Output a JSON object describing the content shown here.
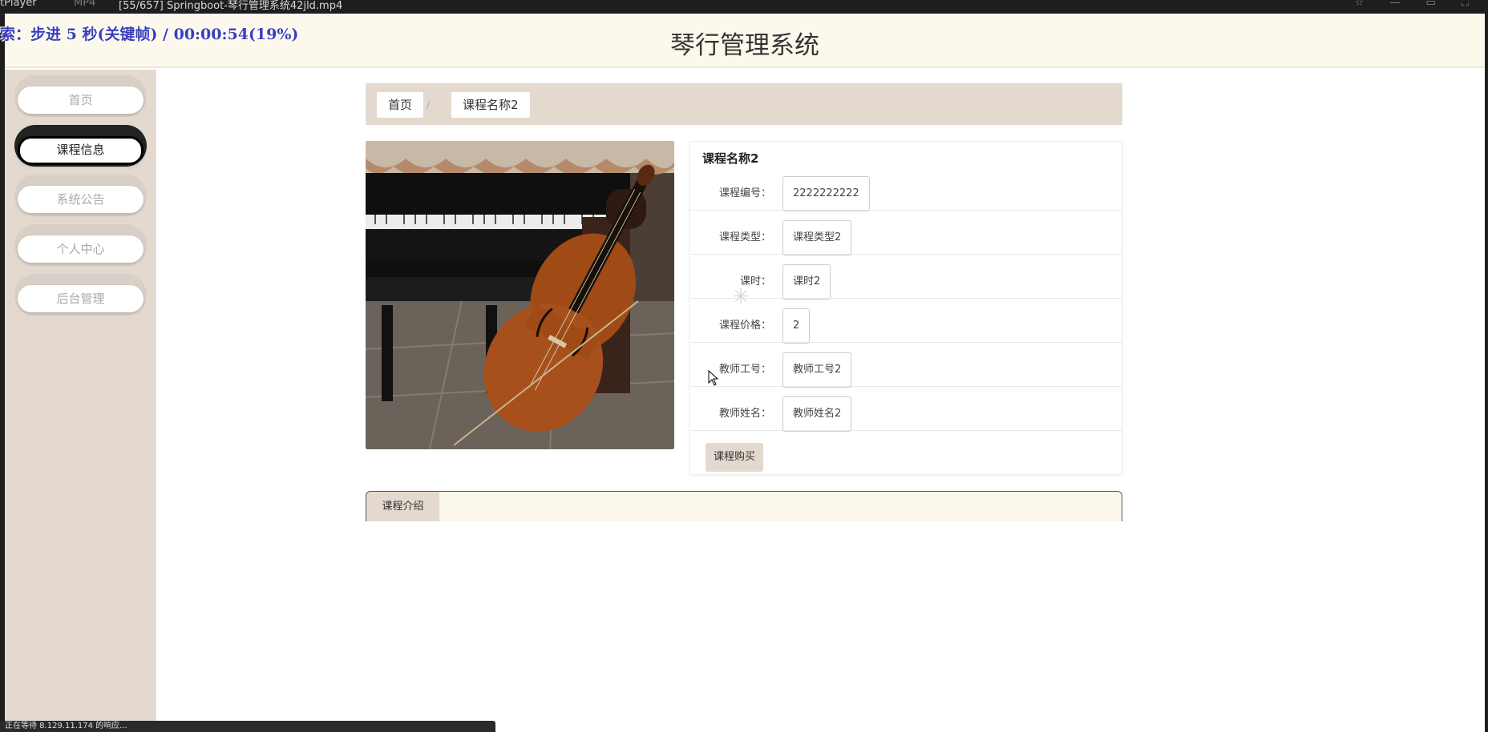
{
  "player": {
    "tab1": "tPlayer",
    "tab2": "MP4",
    "title": "[55/657] Springboot-琴行管理系统42jld.mp4",
    "overlay": "索：步进 5 秒(关键帧) / 00:00:54(19%)",
    "window_controls": "☆ — ▭ ⛶",
    "status": "正在等待 8.129.11.174 的响应..."
  },
  "header": {
    "title": "琴行管理系统"
  },
  "sidebar": {
    "items": [
      {
        "label": "首页",
        "active": false
      },
      {
        "label": "课程信息",
        "active": true
      },
      {
        "label": "系统公告",
        "active": false
      },
      {
        "label": "个人中心",
        "active": false
      },
      {
        "label": "后台管理",
        "active": false
      }
    ]
  },
  "breadcrumb": {
    "home": "首页",
    "separator": "/",
    "current": "课程名称2"
  },
  "course": {
    "name": "课程名称2",
    "fields": [
      {
        "label": "课程编号：",
        "value": "2222222222"
      },
      {
        "label": "课程类型：",
        "value": "课程类型2"
      },
      {
        "label": "课时：",
        "value": "课时2"
      },
      {
        "label": "课程价格：",
        "value": "2"
      },
      {
        "label": "教师工号：",
        "value": "教师工号2"
      },
      {
        "label": "教师姓名：",
        "value": "教师姓名2"
      }
    ],
    "buy_label": "课程购买"
  },
  "intro": {
    "tab_label": "课程介绍"
  },
  "colors": {
    "accent": "#e3d9cf",
    "header_bg": "#fdf8ec"
  }
}
